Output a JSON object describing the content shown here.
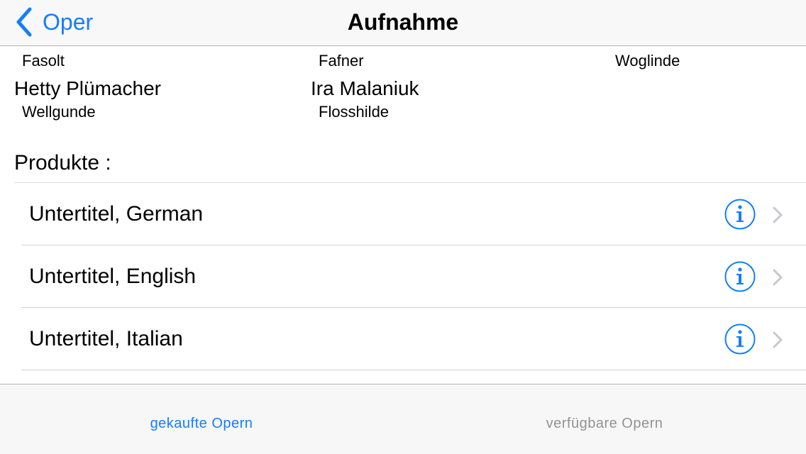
{
  "navbar": {
    "back_label": "Oper",
    "title": "Aufnahme"
  },
  "cast": {
    "row1_roles": [
      "Fasolt",
      "Fafner",
      "Woglinde"
    ],
    "row2": [
      {
        "name": "Hetty Plümacher",
        "role": "Wellgunde"
      },
      {
        "name": "Ira Malaniuk",
        "role": "Flosshilde"
      }
    ]
  },
  "products": {
    "header": "Produkte :",
    "items": [
      {
        "label": "Untertitel, German"
      },
      {
        "label": "Untertitel, English"
      },
      {
        "label": "Untertitel, Italian"
      }
    ]
  },
  "tabbar": {
    "tabs": [
      {
        "label": "gekaufte Opern",
        "selected": true
      },
      {
        "label": "verfügbare Opern",
        "selected": false
      }
    ]
  },
  "colors": {
    "accent": "#147efb",
    "inactive_tab": "#929292",
    "chevron": "#c7c7cc"
  }
}
